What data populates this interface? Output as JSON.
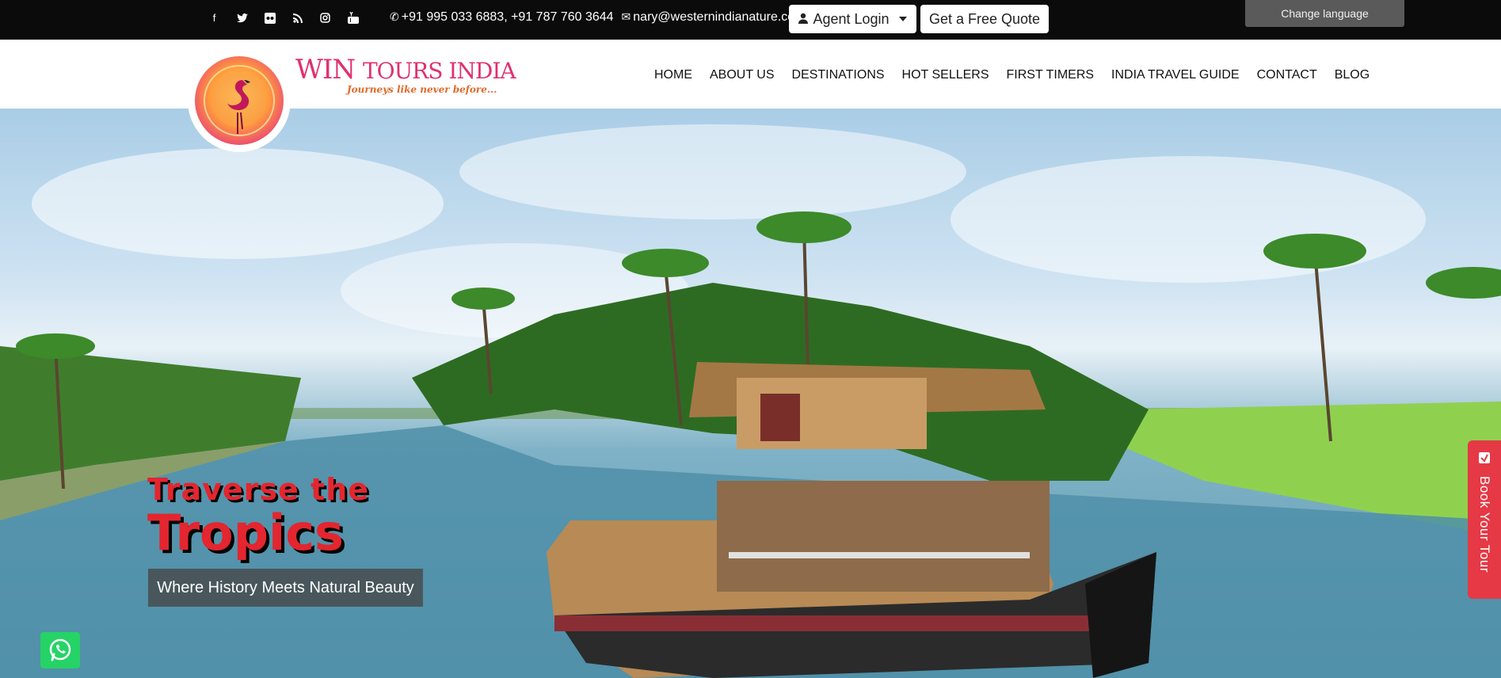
{
  "topbar": {
    "social_icons": [
      "facebook-icon",
      "twitter-icon",
      "flickr-icon",
      "rss-icon",
      "instagram-icon",
      "youtube-icon"
    ],
    "phone": "+91 995 033 6883, +91 787 760 3644",
    "email": "nary@westernindianature.com",
    "agent_login": "Agent Login",
    "quote": "Get a Free Quote",
    "language": "Change language"
  },
  "brand": {
    "name_big": "WIN",
    "name_small": "TOURS INDIA",
    "tagline": "Journeys like never before..."
  },
  "nav": {
    "items": [
      "HOME",
      "ABOUT US",
      "DESTINATIONS",
      "HOT SELLERS",
      "FIRST TIMERS",
      "INDIA TRAVEL GUIDE",
      "CONTACT",
      "BLOG"
    ]
  },
  "hero": {
    "line1": "Traverse the",
    "line2": "Tropics",
    "subtitle": "Where History Meets Natural Beauty"
  },
  "book_tab": {
    "label": "Book Your Tour"
  },
  "colors": {
    "brand_pink": "#e0306f",
    "hero_red": "#e3262f",
    "whatsapp": "#25d366",
    "book_tab": "#e53945"
  }
}
